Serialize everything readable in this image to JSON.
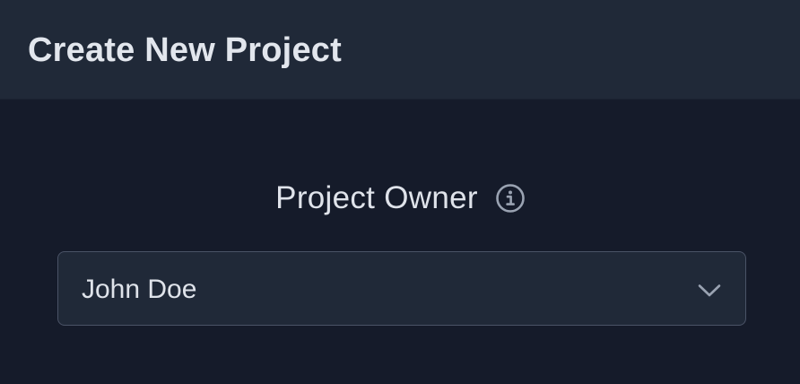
{
  "header": {
    "title": "Create New Project"
  },
  "form": {
    "owner_field": {
      "label": "Project Owner",
      "info_icon": "info-circle-icon",
      "selected_value": "John Doe",
      "dropdown_icon": "chevron-down-icon"
    }
  },
  "colors": {
    "background": "#151b2a",
    "header_background": "#202938",
    "text": "#dfe3ea",
    "muted_icon": "#9aa3b2",
    "input_border": "#4a5366"
  }
}
